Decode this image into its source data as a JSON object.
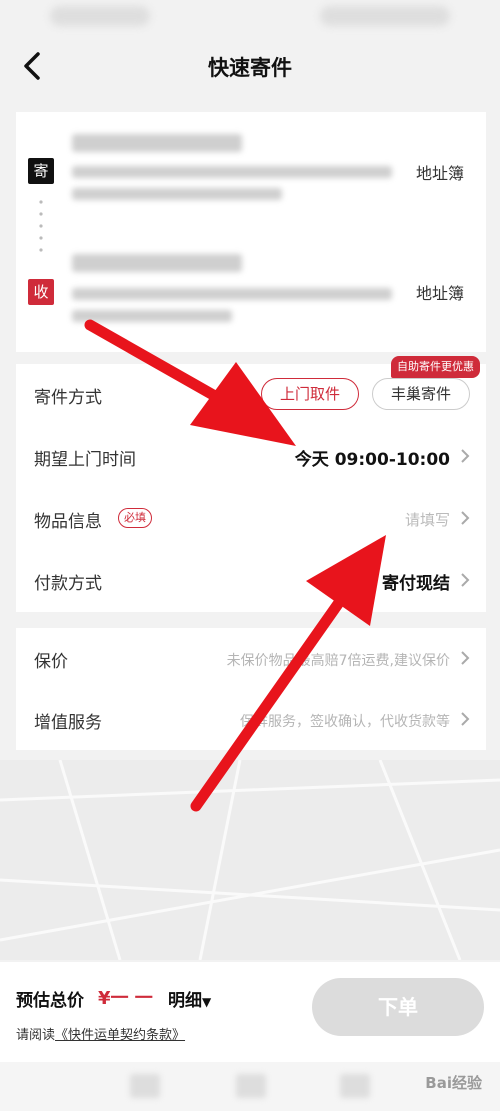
{
  "nav": {
    "title": "快速寄件"
  },
  "sender": {
    "tag": "寄",
    "address_book": "地址簿"
  },
  "receiver": {
    "tag": "收",
    "address_book": "地址簿"
  },
  "shipping": {
    "method_label": "寄件方式",
    "options": [
      "上门取件",
      "丰巢寄件"
    ],
    "selected": "上门取件",
    "promo": "自助寄件更优惠"
  },
  "pickup_time": {
    "label": "期望上门时间",
    "value": "今天 09:00-10:00"
  },
  "item_info": {
    "label": "物品信息",
    "badge": "必填",
    "placeholder": "请填写"
  },
  "payment": {
    "label": "付款方式",
    "value": "寄付现结"
  },
  "insurance": {
    "label": "保价",
    "hint": "未保价物品最高赔7倍运费,建议保价"
  },
  "value_added": {
    "label": "增值服务",
    "hint": "保鲜服务，签收确认，代收货款等"
  },
  "footer": {
    "total_label": "预估总价",
    "price": "¥一 一",
    "detail": "明细",
    "agree_prefix": "请阅读",
    "agree_link": "《快件运单契约条款》",
    "order_button": "下单"
  },
  "watermark": "Bai经验",
  "colors": {
    "accent": "#cf2b3a",
    "arrow": "#e8141c",
    "disabled_button": "#dcdcdc"
  }
}
